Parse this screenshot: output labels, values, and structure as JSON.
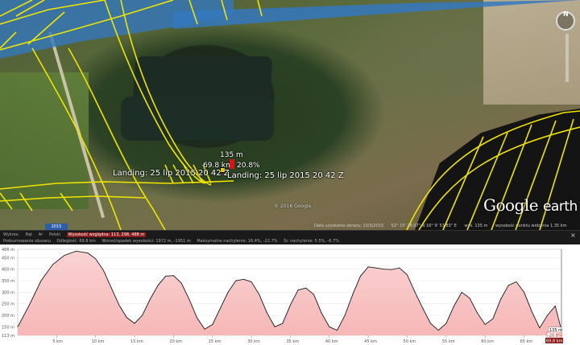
{
  "map": {
    "distance_label": "135 m",
    "slope_dist_label": "69.8 km",
    "slope_pct_label": "20.8%",
    "landing_label_left": "Landing: 25 lip 2015 20 42 Z",
    "landing_label_right": "Landing: 25 lip 2015 20 42 Z",
    "copyright": "© 2016 Google",
    "logo_main": "Google",
    "logo_suffix": "earth",
    "date_badge": "2015"
  },
  "status_bar": {
    "imagery_date": "Data uzyskania obrazu: 10/3/2015",
    "coords": "52° 15' 28.07\" N   16° 9' 53.83\" E",
    "elevation": "wys. 135 m",
    "eye_alt": "wysokość punktu widzenia 1.35 km"
  },
  "stats": {
    "row1": {
      "label_view": "Wykres:",
      "label_all": "Ręt",
      "label_ar": "Ar",
      "label_path": "Polski",
      "highlight": "Wysokość względna: 113, 298, 488 m"
    },
    "row2": {
      "range": "Podsumowanie obszaru",
      "distance": "Odległość: 69.8 km",
      "gain": "Wzrost/spadek wysokości: 1972 m, -1951 m",
      "max_slope": "Maksymalne nachylenie: 16.4%, -22.7%",
      "avg_slope": "Śr. nachylenie: 5.5%, -6.7%"
    },
    "close_label": "×"
  },
  "chart_data": {
    "type": "area",
    "ylabel": "",
    "y_ticks": [
      "486 m",
      "450 m",
      "400 m",
      "350 m",
      "300 m",
      "250 m",
      "200 m",
      "150 m",
      "113 m"
    ],
    "x_ticks": [
      "5 km",
      "10 km",
      "15 km",
      "20 km",
      "25 km",
      "30 km",
      "35 km",
      "40 km",
      "45 km",
      "50 km",
      "55 km",
      "60 km",
      "65 km"
    ],
    "ylim": [
      113,
      486
    ],
    "xlim": [
      0,
      69.8
    ],
    "fill_color": "#f6b7b7",
    "line_color": "#1a1a1a",
    "current_value_label": "135 m",
    "current_slope_label": "-20.8%",
    "end_label": "69.8 km",
    "x": [
      0,
      1.5,
      3,
      4.5,
      6,
      7.5,
      9,
      10,
      11,
      12,
      13,
      14,
      15,
      16,
      17,
      18,
      19,
      20,
      21,
      22,
      23,
      24,
      25,
      26,
      27,
      28,
      29,
      30,
      31,
      32,
      33,
      34,
      35,
      36,
      37,
      38,
      39,
      40,
      41,
      42,
      43,
      44,
      45,
      46,
      47,
      48,
      49,
      50,
      51,
      52,
      53,
      54,
      55,
      56,
      57,
      58,
      59,
      60,
      61,
      62,
      63,
      64,
      65,
      66,
      67,
      68,
      69,
      69.8
    ],
    "y": [
      150,
      245,
      350,
      420,
      460,
      478,
      470,
      445,
      395,
      320,
      245,
      190,
      165,
      200,
      270,
      330,
      370,
      372,
      340,
      270,
      190,
      140,
      160,
      230,
      300,
      350,
      356,
      345,
      290,
      210,
      150,
      165,
      245,
      310,
      318,
      290,
      210,
      150,
      135,
      200,
      290,
      370,
      410,
      405,
      400,
      398,
      405,
      375,
      300,
      230,
      165,
      135,
      165,
      240,
      300,
      275,
      210,
      160,
      185,
      270,
      330,
      345,
      300,
      215,
      145,
      200,
      240,
      135
    ]
  }
}
